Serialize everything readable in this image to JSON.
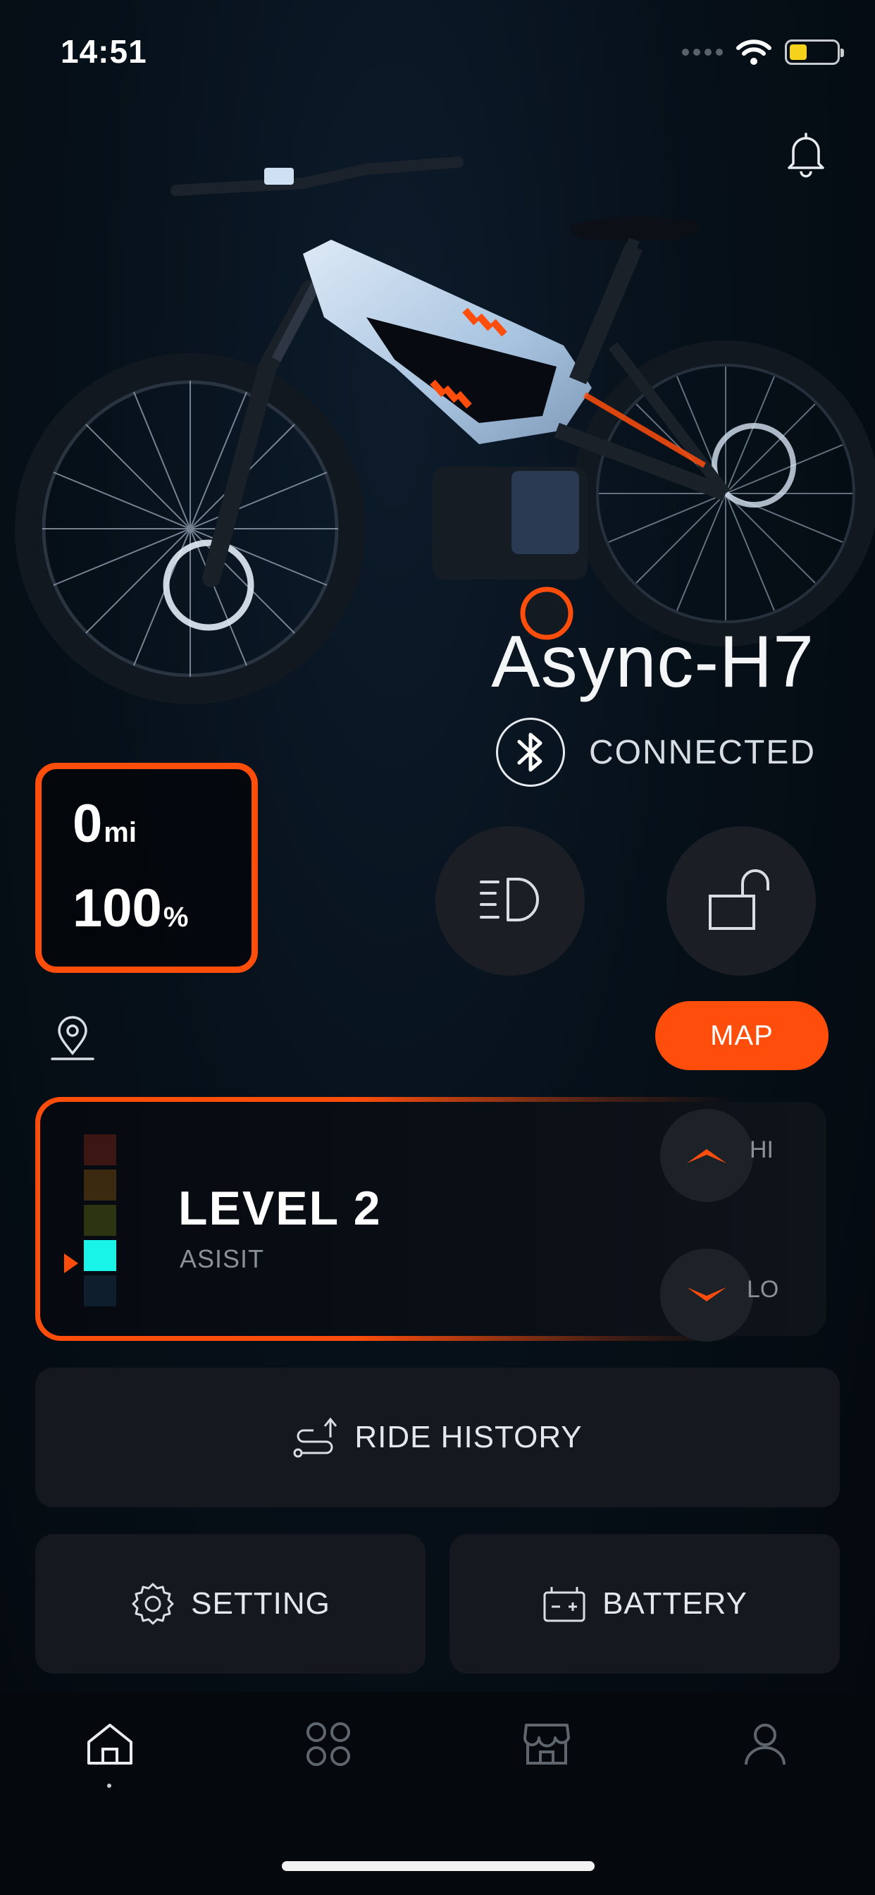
{
  "status_bar": {
    "time": "14:51"
  },
  "bike": {
    "name": "Async-H7",
    "connection_status": "CONNECTED"
  },
  "stats": {
    "distance_value": "0",
    "distance_unit": "mi",
    "battery_value": "100",
    "battery_unit": "%"
  },
  "map_button_label": "MAP",
  "assist": {
    "level_title": "LEVEL 2",
    "subtitle": "ASISIT",
    "hi_label": "HI",
    "lo_label": "LO",
    "current_level": 2,
    "level_colors": [
      "#3b1612",
      "#3c2a10",
      "#2c3412",
      "#19f4e8",
      "#0e1e2c"
    ]
  },
  "actions": {
    "ride_history": "RIDE HISTORY",
    "setting": "SETTING",
    "battery": "BATTERY"
  },
  "colors": {
    "accent": "#ff4d0c",
    "level_active": "#19f4e8"
  },
  "tabs": [
    {
      "icon": "home-icon",
      "active": true
    },
    {
      "icon": "apps-icon",
      "active": false
    },
    {
      "icon": "store-icon",
      "active": false
    },
    {
      "icon": "profile-icon",
      "active": false
    }
  ]
}
